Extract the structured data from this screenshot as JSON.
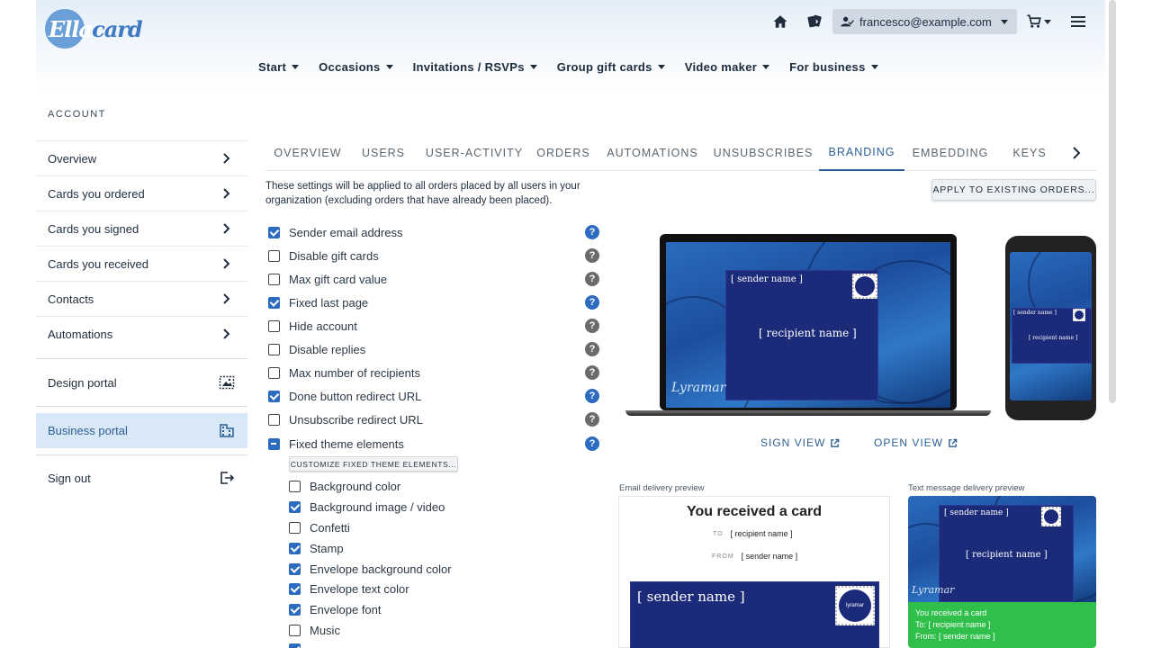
{
  "brand": {
    "logo_text_a": "Ella",
    "logo_text_b": "card",
    "accent": "#2c5f95",
    "highlight": "#d9e8f6"
  },
  "header": {
    "user_email": "francesco@example.com",
    "icons": [
      "home-icon",
      "cards-icon",
      "user-icon",
      "cart-icon",
      "menu-icon"
    ]
  },
  "nav": {
    "items": [
      {
        "label": "Start"
      },
      {
        "label": "Occasions"
      },
      {
        "label": "Invitations / RSVPs"
      },
      {
        "label": "Group gift cards"
      },
      {
        "label": "Video maker"
      },
      {
        "label": "For business"
      }
    ]
  },
  "sidebar": {
    "section_label": "ACCOUNT",
    "items": [
      {
        "label": "Overview"
      },
      {
        "label": "Cards you ordered"
      },
      {
        "label": "Cards you signed"
      },
      {
        "label": "Cards you received"
      },
      {
        "label": "Contacts"
      },
      {
        "label": "Automations"
      }
    ],
    "design_portal": "Design portal",
    "business_portal": "Business portal",
    "sign_out": "Sign out"
  },
  "tabs": {
    "items": [
      {
        "label": "OVERVIEW"
      },
      {
        "label": "USERS"
      },
      {
        "label": "USER-ACTIVITY"
      },
      {
        "label": "ORDERS"
      },
      {
        "label": "AUTOMATIONS"
      },
      {
        "label": "UNSUBSCRIBES"
      },
      {
        "label": "BRANDING"
      },
      {
        "label": "EMBEDDING"
      },
      {
        "label": "KEYS"
      }
    ],
    "active": "BRANDING"
  },
  "branding": {
    "intro": "These settings will be applied to all orders placed by all users in your organization (excluding orders that have already been placed).",
    "apply_button": "APPLY TO EXISTING ORDERS...",
    "options": [
      {
        "label": "Sender email address",
        "checked": true,
        "help": "blue"
      },
      {
        "label": "Disable gift cards",
        "checked": false,
        "help": "gray"
      },
      {
        "label": "Max gift card value",
        "checked": false,
        "help": "gray"
      },
      {
        "label": "Fixed last page",
        "checked": true,
        "help": "blue"
      },
      {
        "label": "Hide account",
        "checked": false,
        "help": "gray"
      },
      {
        "label": "Disable replies",
        "checked": false,
        "help": "gray"
      },
      {
        "label": "Max number of recipients",
        "checked": false,
        "help": "gray"
      },
      {
        "label": "Done button redirect URL",
        "checked": true,
        "help": "blue"
      },
      {
        "label": "Unsubscribe redirect URL",
        "checked": false,
        "help": "gray"
      },
      {
        "label": "Fixed theme elements",
        "checked": "indeterminate",
        "help": "blue"
      }
    ],
    "customize_button": "CUSTOMIZE FIXED THEME ELEMENTS...",
    "theme_elements": [
      {
        "label": "Background color",
        "checked": false
      },
      {
        "label": "Background image / video",
        "checked": true
      },
      {
        "label": "Confetti",
        "checked": false
      },
      {
        "label": "Stamp",
        "checked": true
      },
      {
        "label": "Envelope background color",
        "checked": true
      },
      {
        "label": "Envelope text color",
        "checked": true
      },
      {
        "label": "Envelope font",
        "checked": true
      },
      {
        "label": "Music",
        "checked": false
      }
    ]
  },
  "preview": {
    "sender_placeholder": "[ sender name ]",
    "recipient_placeholder": "[ recipient name ]",
    "signature": "Lyramar",
    "stamp_text": "lyramar",
    "sign_view": "SIGN VIEW",
    "open_view": "OPEN VIEW",
    "email_label": "Email delivery preview",
    "sms_label": "Text message delivery preview",
    "email_title": "You received a card",
    "to_label": "TO",
    "from_label": "FROM",
    "sms_line1": "You received a card",
    "sms_line2": "To: [ recipient name ]",
    "sms_line3": "From: [ sender name ]"
  }
}
